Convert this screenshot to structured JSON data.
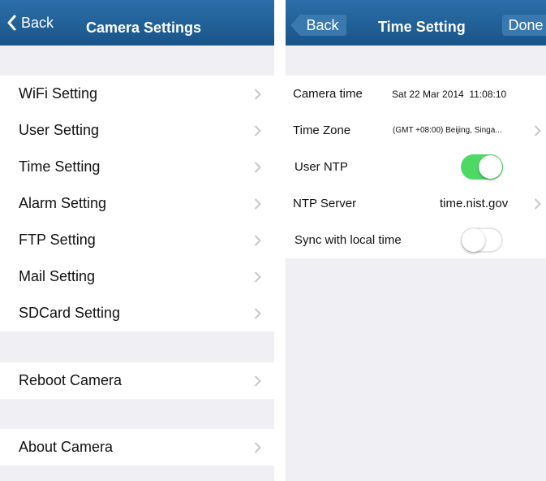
{
  "left": {
    "back_label": "Back",
    "title": "Camera Settings",
    "settings": [
      "WiFi Setting",
      "User Setting",
      "Time Setting",
      "Alarm Setting",
      "FTP Setting",
      "Mail Setting",
      "SDCard Setting"
    ],
    "reboot": "Reboot Camera",
    "about": "About Camera"
  },
  "right": {
    "back_label": "Back",
    "title": "Time Setting",
    "done_label": "Done",
    "camera_time_label": "Camera time",
    "camera_time_value": "Sat 22 Mar 2014  11:08:10",
    "time_zone_label": "Time Zone",
    "time_zone_value": "(GMT +08:00) Beijing, Singa...",
    "user_ntp_label": "User NTP",
    "user_ntp_on": true,
    "ntp_server_label": "NTP Server",
    "ntp_server_value": "time.nist.gov",
    "sync_label": "Sync with local time",
    "sync_on": false
  },
  "icons": [
    "chevron-left-icon",
    "chevron-right-icon"
  ],
  "colors": {
    "navbar": "#195489",
    "toggle_on": "#4cd964",
    "background": "#efeff4"
  }
}
